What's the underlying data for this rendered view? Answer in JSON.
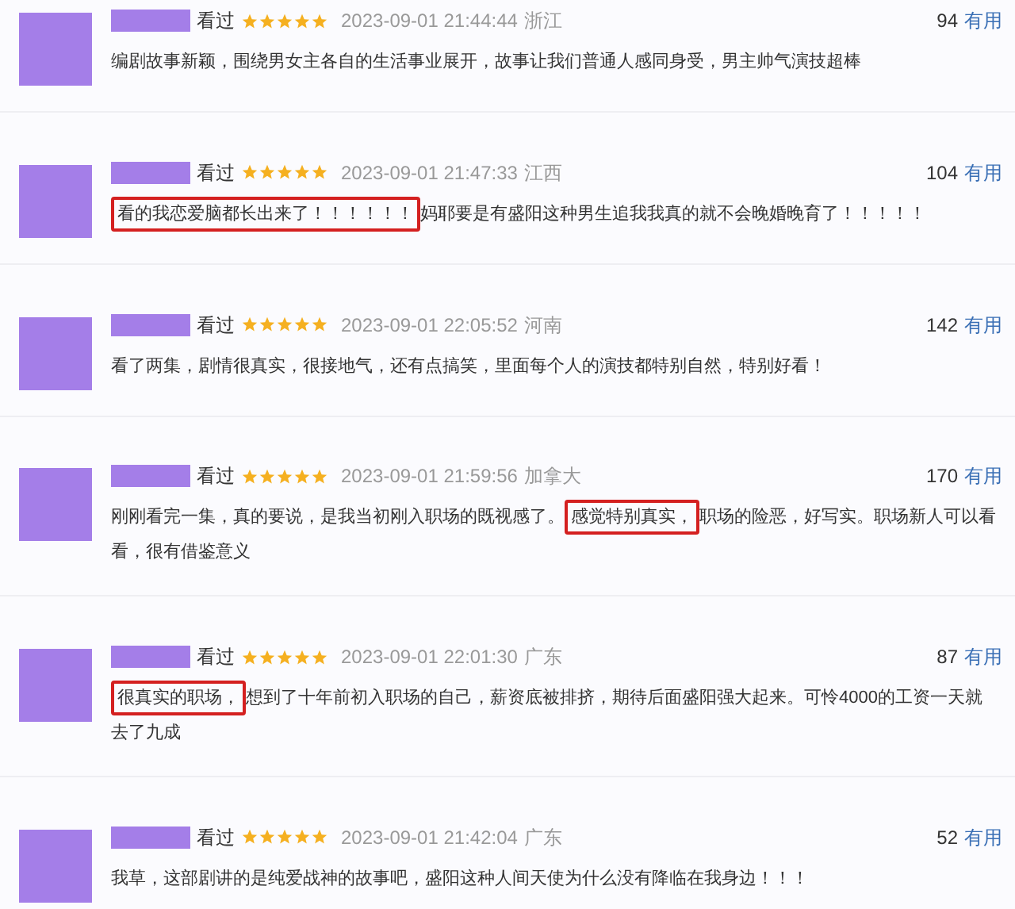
{
  "reviews": [
    {
      "watched_label": "看过",
      "stars": 5,
      "time": "2023-09-01 21:44:44",
      "location": "浙江",
      "votes": "94",
      "useful_label": "有用",
      "content": [
        {
          "text": "编剧故事新颖，围绕男女主各自的生活事业展开，故事让我们普通人感同身受，男主帅气演技超棒",
          "highlighted": false
        }
      ]
    },
    {
      "watched_label": "看过",
      "stars": 5,
      "time": "2023-09-01 21:47:33",
      "location": "江西",
      "votes": "104",
      "useful_label": "有用",
      "content": [
        {
          "text": "看的我恋爱脑都长出来了！！！！！！",
          "highlighted": true
        },
        {
          "text": "妈耶要是有盛阳这种男生追我我真的就不会晚婚晚育了！！！！！",
          "highlighted": false
        }
      ]
    },
    {
      "watched_label": "看过",
      "stars": 5,
      "time": "2023-09-01 22:05:52",
      "location": "河南",
      "votes": "142",
      "useful_label": "有用",
      "content": [
        {
          "text": "看了两集，剧情很真实，很接地气，还有点搞笑，里面每个人的演技都特别自然，特别好看！",
          "highlighted": false
        }
      ]
    },
    {
      "watched_label": "看过",
      "stars": 5,
      "time": "2023-09-01 21:59:56",
      "location": "加拿大",
      "votes": "170",
      "useful_label": "有用",
      "content": [
        {
          "text": "刚刚看完一集，真的要说，是我当初刚入职场的既视感了。",
          "highlighted": false
        },
        {
          "text": "感觉特别真实，",
          "highlighted": true
        },
        {
          "text": "职场的险恶，好写实。职场新人可以看看，很有借鉴意义",
          "highlighted": false
        }
      ]
    },
    {
      "watched_label": "看过",
      "stars": 5,
      "time": "2023-09-01 22:01:30",
      "location": "广东",
      "votes": "87",
      "useful_label": "有用",
      "content": [
        {
          "text": "很真实的职场，",
          "highlighted": true
        },
        {
          "text": "想到了十年前初入职场的自己，薪资底被排挤，期待后面盛阳强大起来。可怜4000的工资一天就去了九成",
          "highlighted": false
        }
      ]
    },
    {
      "watched_label": "看过",
      "stars": 5,
      "time": "2023-09-01 21:42:04",
      "location": "广东",
      "votes": "52",
      "useful_label": "有用",
      "content": [
        {
          "text": "我草，这部剧讲的是纯爱战神的故事吧，盛阳这种人间天使为什么没有降临在我身边！！！",
          "highlighted": false
        }
      ]
    }
  ]
}
